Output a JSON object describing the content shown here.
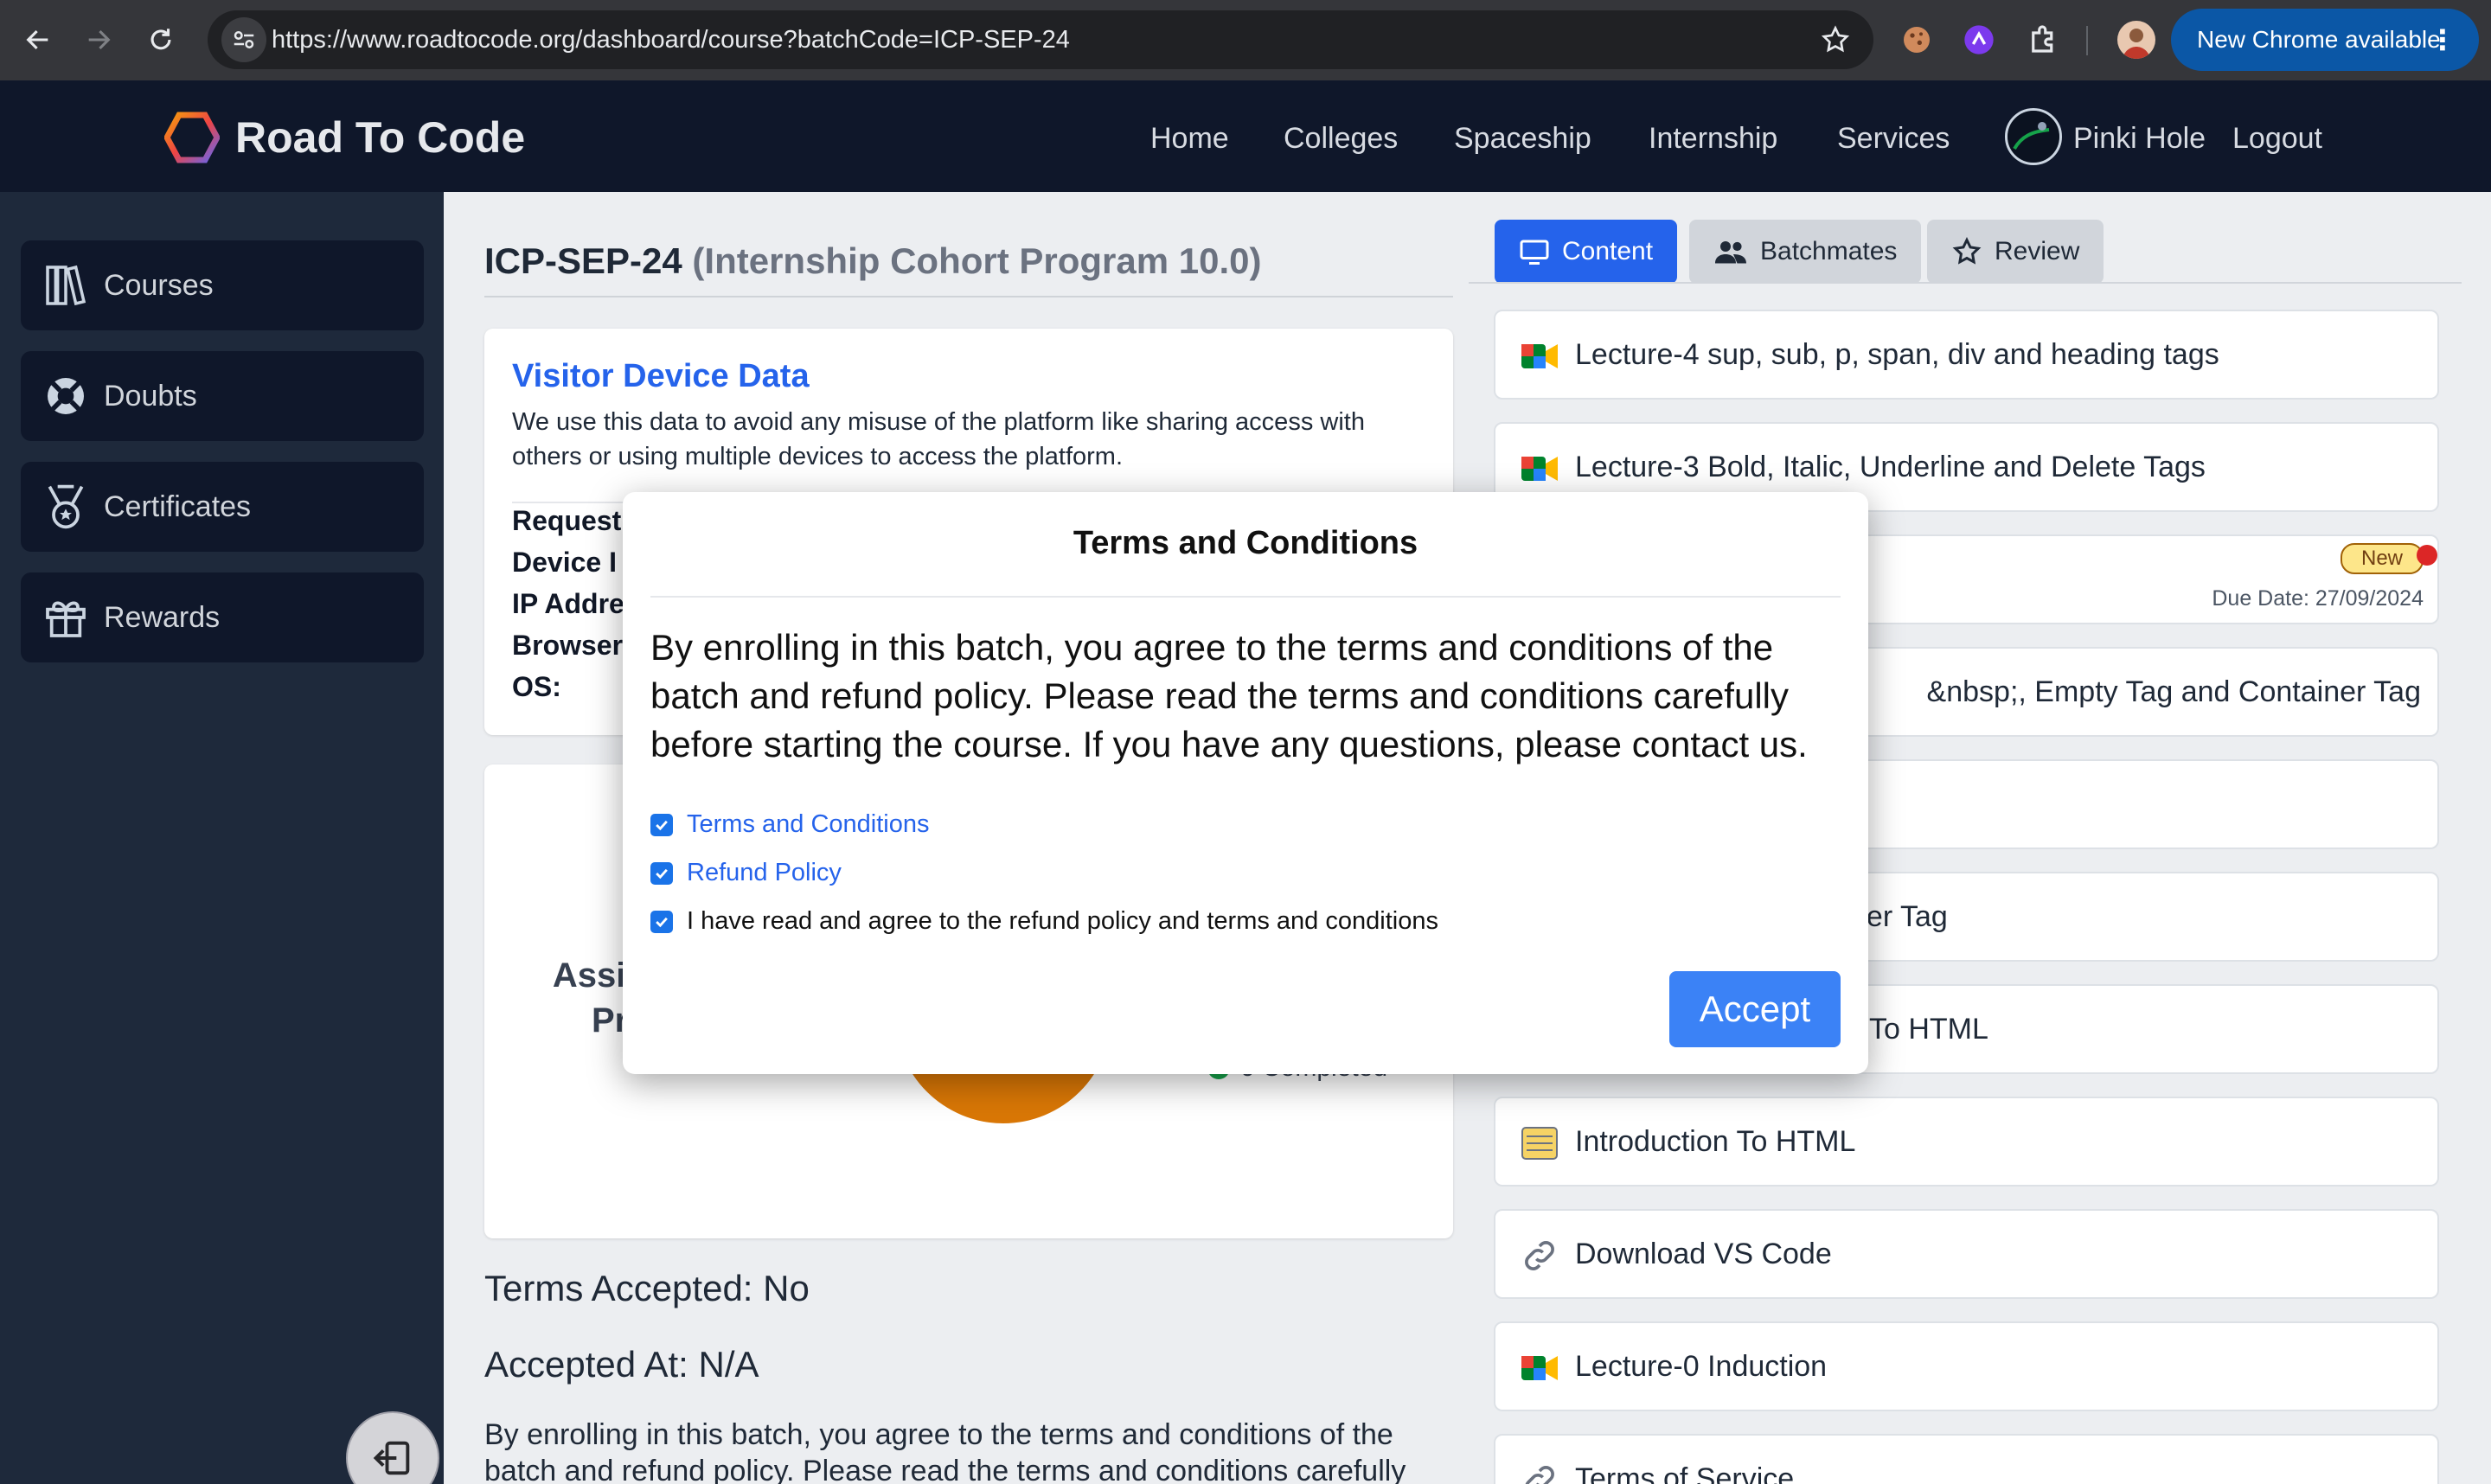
{
  "browser": {
    "url": "https://www.roadtocode.org/dashboard/course?batchCode=ICP-SEP-24",
    "update_label": "New Chrome available"
  },
  "navbar": {
    "brand": "Road To Code",
    "links": [
      "Home",
      "Colleges",
      "Spaceship",
      "Internship",
      "Services"
    ],
    "user_name": "Pinki Hole",
    "logout": "Logout"
  },
  "sidebar": {
    "items": [
      {
        "label": "Courses",
        "icon": "books-icon"
      },
      {
        "label": "Doubts",
        "icon": "lifebuoy-icon"
      },
      {
        "label": "Certificates",
        "icon": "medal-icon"
      },
      {
        "label": "Rewards",
        "icon": "gift-icon"
      }
    ]
  },
  "course": {
    "code": "ICP-SEP-24",
    "name": "(Internship Cohort Program 10.0)"
  },
  "visitor": {
    "title": "Visitor Device Data",
    "description": "We use this data to avoid any misuse of the platform like sharing access with others or using multiple devices to access the platform.",
    "rows": [
      "Request",
      "Device I",
      "IP Addre",
      "Browser",
      "OS:"
    ]
  },
  "assignments": {
    "heading_line1": "Assi",
    "heading_line2": "Pr",
    "legend_completed": "0 Completed"
  },
  "terms_status": {
    "accepted": "Terms Accepted: No",
    "accepted_at": "Accepted At: N/A",
    "text": "By enrolling in this batch, you agree to the terms and conditions of the batch and refund policy. Please read the terms and conditions carefully"
  },
  "tabs": {
    "content": "Content",
    "batchmates": "Batchmates",
    "review": "Review"
  },
  "lectures": [
    {
      "title": "Lecture-4 sup, sub, p, span, div and heading tags",
      "icon": "video-icon"
    },
    {
      "title": "Lecture-3 Bold, Italic, Underline and Delete Tags",
      "icon": "video-icon"
    },
    {
      "title": "",
      "icon": "",
      "badge": "New",
      "due": "Due Date: 27/09/2024"
    },
    {
      "title": "&nbsp;, Empty Tag and Container Tag",
      "icon": ""
    },
    {
      "title": ";",
      "icon": ""
    },
    {
      "title": "ner Tag",
      "icon": ""
    },
    {
      "title": "To HTML",
      "icon": ""
    },
    {
      "title": "Introduction To HTML",
      "icon": "notes-icon"
    },
    {
      "title": "Download VS Code",
      "icon": "link-icon"
    },
    {
      "title": "Lecture-0 Induction",
      "icon": "video-icon"
    },
    {
      "title": "Terms of Service",
      "icon": "link-icon"
    }
  ],
  "modal": {
    "title": "Terms and Conditions",
    "body": "By enrolling in this batch, you agree to the terms and conditions of the batch and refund policy. Please read the terms and conditions carefully before starting the course. If you have any questions, please contact us.",
    "checkboxes": [
      {
        "label": "Terms and Conditions",
        "checked": true
      },
      {
        "label": "Refund Policy",
        "checked": true
      },
      {
        "label": "I have read and agree to the refund policy and terms and conditions",
        "checked": true
      }
    ],
    "accept_label": "Accept"
  },
  "colors": {
    "accent": "#2563eb",
    "navbar": "#0f172a",
    "sidebar": "#1e293b",
    "donut": "#d97706",
    "completed": "#16a34a"
  }
}
